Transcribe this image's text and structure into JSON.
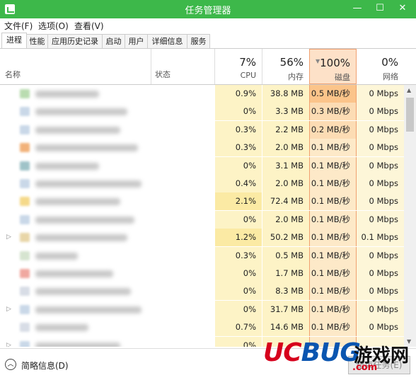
{
  "window": {
    "title": "任务管理器",
    "min": "—",
    "max": "☐",
    "close": "✕"
  },
  "menu": [
    "文件(F)",
    "选项(O)",
    "查看(V)"
  ],
  "tabs": [
    "进程",
    "性能",
    "应用历史记录",
    "启动",
    "用户",
    "详细信息",
    "服务"
  ],
  "active_tab": 0,
  "columns": {
    "name": "名称",
    "status": "状态",
    "cpu": {
      "pct": "7%",
      "label": "CPU"
    },
    "memory": {
      "pct": "56%",
      "label": "内存"
    },
    "disk": {
      "pct": "100%",
      "label": "磁盘"
    },
    "network": {
      "pct": "0%",
      "label": "网络"
    }
  },
  "rows": [
    {
      "expander": false,
      "cpu": "0.9%",
      "mem": "38.8 MB",
      "disk": "0.5 MB/秒",
      "net": "0 Mbps",
      "icon_color": "#b9dcb0"
    },
    {
      "expander": false,
      "cpu": "0%",
      "mem": "3.3 MB",
      "disk": "0.3 MB/秒",
      "net": "0 Mbps",
      "icon_color": "#c9d8e8"
    },
    {
      "expander": false,
      "cpu": "0.3%",
      "mem": "2.2 MB",
      "disk": "0.2 MB/秒",
      "net": "0 Mbps",
      "icon_color": "#c9d8e8"
    },
    {
      "expander": false,
      "cpu": "0.3%",
      "mem": "2.0 MB",
      "disk": "0.1 MB/秒",
      "net": "0 Mbps",
      "icon_color": "#f2b27a"
    },
    {
      "expander": false,
      "cpu": "0%",
      "mem": "3.1 MB",
      "disk": "0.1 MB/秒",
      "net": "0 Mbps",
      "icon_color": "#9fc3c8"
    },
    {
      "expander": false,
      "cpu": "0.4%",
      "mem": "2.0 MB",
      "disk": "0.1 MB/秒",
      "net": "0 Mbps",
      "icon_color": "#c9d8e8"
    },
    {
      "expander": false,
      "cpu": "2.1%",
      "mem": "72.4 MB",
      "disk": "0.1 MB/秒",
      "net": "0 Mbps",
      "icon_color": "#f5d98a"
    },
    {
      "expander": false,
      "cpu": "0%",
      "mem": "2.0 MB",
      "disk": "0.1 MB/秒",
      "net": "0 Mbps",
      "icon_color": "#c9d8e8"
    },
    {
      "expander": true,
      "cpu": "1.2%",
      "mem": "50.2 MB",
      "disk": "0.1 MB/秒",
      "net": "0.1 Mbps",
      "icon_color": "#e8d6a8"
    },
    {
      "expander": false,
      "cpu": "0.3%",
      "mem": "0.5 MB",
      "disk": "0.1 MB/秒",
      "net": "0 Mbps",
      "icon_color": "#d6e4d0"
    },
    {
      "expander": false,
      "cpu": "0%",
      "mem": "1.7 MB",
      "disk": "0.1 MB/秒",
      "net": "0 Mbps",
      "icon_color": "#f0a8a0"
    },
    {
      "expander": false,
      "cpu": "0%",
      "mem": "8.3 MB",
      "disk": "0.1 MB/秒",
      "net": "0 Mbps",
      "icon_color": "#d8dde6"
    },
    {
      "expander": true,
      "cpu": "0%",
      "mem": "31.7 MB",
      "disk": "0.1 MB/秒",
      "net": "0 Mbps",
      "icon_color": "#c9d8e8"
    },
    {
      "expander": false,
      "cpu": "0.7%",
      "mem": "14.6 MB",
      "disk": "0.1 MB/秒",
      "net": "0 Mbps",
      "icon_color": "#d8dde6"
    },
    {
      "expander": true,
      "cpu": "0%",
      "mem": "",
      "disk": "",
      "net": "",
      "icon_color": "#c9d8e8"
    }
  ],
  "footer": {
    "fewer_details": "简略信息(D)",
    "end_task": "结束任务(E)"
  },
  "watermark": {
    "logo_uc": "UC",
    "logo_bug": "BUG",
    "cn": "游戏网",
    "url": ".com"
  },
  "colors": {
    "title_bar": "#3db84a",
    "cpu_col": "#fdf3c6",
    "cpu_col_hi": "#fbeaa4",
    "mem_col": "#fdf3c6",
    "disk_hi": "#fbc48a",
    "disk_mid": "#fcdcb4",
    "disk_low": "#fde9c8",
    "net_col": "#fdf6d8",
    "wm_uc": "#d6001c",
    "wm_bug": "#0a55b0"
  }
}
